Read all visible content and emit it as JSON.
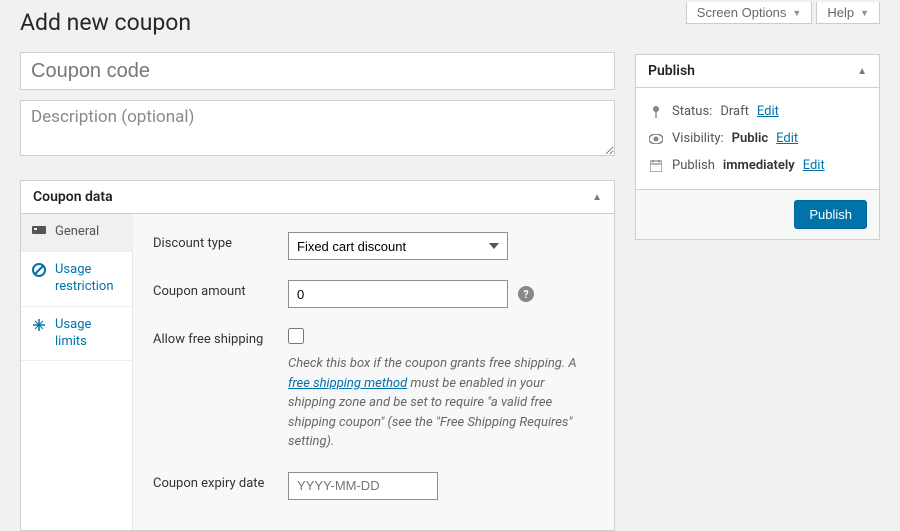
{
  "topbar": {
    "screen_options": "Screen Options",
    "help": "Help"
  },
  "page_title": "Add new coupon",
  "coupon_code": {
    "placeholder": "Coupon code",
    "value": ""
  },
  "description": {
    "placeholder": "Description (optional)",
    "value": ""
  },
  "coupon_data": {
    "panel_title": "Coupon data",
    "tabs": {
      "general": "General",
      "usage_restriction": "Usage restriction",
      "usage_limits": "Usage limits"
    },
    "fields": {
      "discount_type": {
        "label": "Discount type",
        "value": "Fixed cart discount"
      },
      "coupon_amount": {
        "label": "Coupon amount",
        "value": "0"
      },
      "allow_free_shipping": {
        "label": "Allow free shipping",
        "help_pre": "Check this box if the coupon grants free shipping. A ",
        "help_link": "free shipping method",
        "help_post": " must be enabled in your shipping zone and be set to require \"a valid free shipping coupon\" (see the \"Free Shipping Requires\" setting)."
      },
      "expiry": {
        "label": "Coupon expiry date",
        "placeholder": "YYYY-MM-DD",
        "value": ""
      }
    }
  },
  "publish": {
    "title": "Publish",
    "status_label": "Status:",
    "status_value": "Draft",
    "status_edit": "Edit",
    "visibility_label": "Visibility:",
    "visibility_value": "Public",
    "visibility_edit": "Edit",
    "schedule_label": "Publish",
    "schedule_value": "immediately",
    "schedule_edit": "Edit",
    "button": "Publish"
  }
}
